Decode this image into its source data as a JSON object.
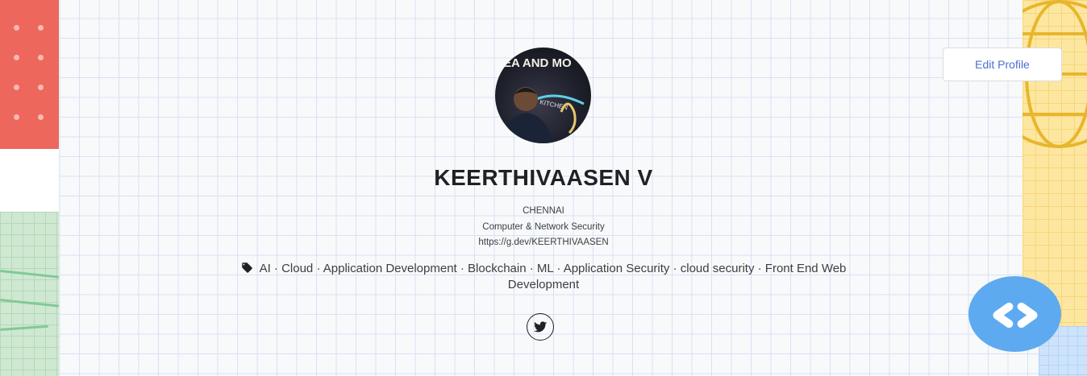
{
  "profile": {
    "name": "KEERTHIVAASEN V",
    "city": "CHENNAI",
    "field": "Computer & Network Security",
    "url": "https://g.dev/KEERTHIVAASEN",
    "tags_line1": "AI · Cloud · Application Development · Blockchain · ML · Application Security · cloud security · Front End Web",
    "tags_line2": "Development",
    "avatar_sign_text": "EA AND MO",
    "avatar_sign_small": "KITCHEN"
  },
  "actions": {
    "edit_profile_label": "Edit Profile"
  },
  "social": {
    "twitter_icon": "twitter-icon"
  },
  "icons": {
    "tag": "tag-icon",
    "globe": "globe-icon",
    "code": "code-icon"
  },
  "colors": {
    "accent_blue": "#4a6fd1",
    "red_deco": "#ee675c",
    "green_deco": "#cfe8d2",
    "yellow_deco": "#fde7a0",
    "blue_badge": "#5eaaf0"
  }
}
